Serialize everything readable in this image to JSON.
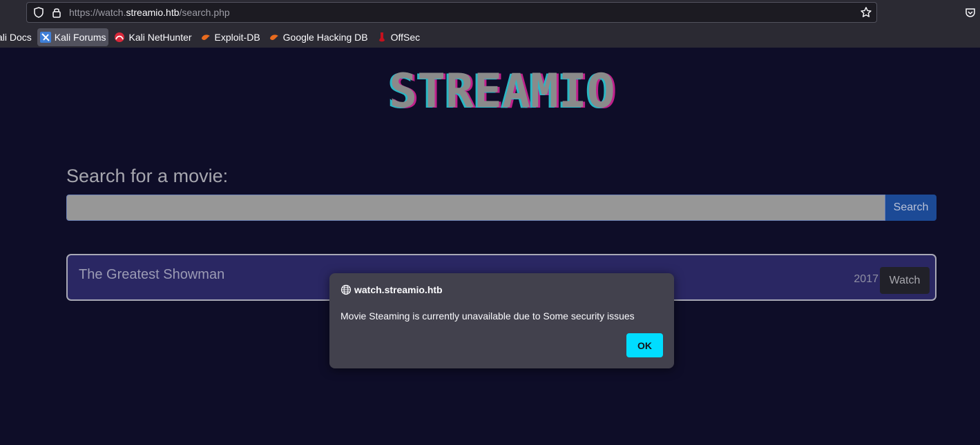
{
  "browser": {
    "url_prefix": "https://watch.",
    "url_host": "streamio.htb",
    "url_path": "/search.php",
    "bookmarks": [
      {
        "label": "ali Docs",
        "icon": "kali-docs-icon"
      },
      {
        "label": "Kali Forums",
        "icon": "kali-forums-icon"
      },
      {
        "label": "Kali NetHunter",
        "icon": "kali-nethunter-icon"
      },
      {
        "label": "Exploit-DB",
        "icon": "exploit-db-icon"
      },
      {
        "label": "Google Hacking DB",
        "icon": "ghdb-icon"
      },
      {
        "label": "OffSec",
        "icon": "offsec-icon"
      }
    ]
  },
  "page": {
    "logo_text": "STREAMIO",
    "search_heading": "Search for a movie:",
    "search_value": "",
    "search_button": "Search"
  },
  "results": [
    {
      "title": "The Greatest Showman",
      "year": "2017",
      "action": "Watch"
    }
  ],
  "dialog": {
    "origin": "watch.streamio.htb",
    "message": "Movie Steaming is currently unavailable due to Some security issues",
    "ok_label": "OK"
  },
  "colors": {
    "page_bg": "#0e0d28",
    "card_bg": "#2a2763",
    "search_button": "#1c4a96",
    "ok_button": "#00ddff",
    "logo_fill": "#8a8a8a",
    "logo_magenta": "#c0208c",
    "logo_cyan": "#2ab7c4"
  }
}
